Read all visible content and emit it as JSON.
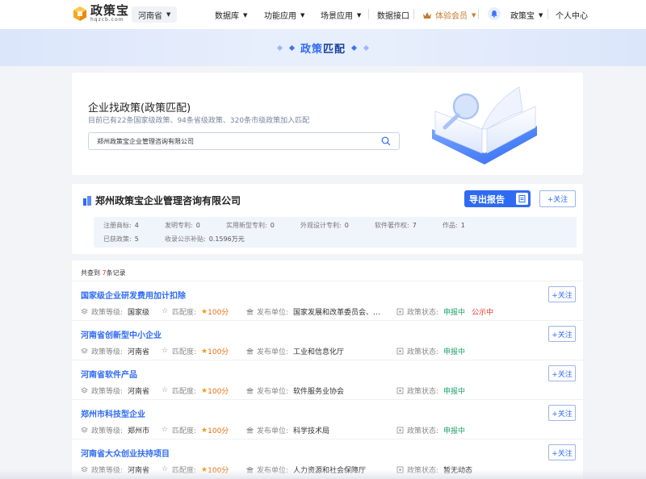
{
  "nav": {
    "logo_cn": "政策宝",
    "logo_en": "hqzcb.com",
    "region": "河南省",
    "items": [
      {
        "label": "数据库",
        "caret": true
      },
      {
        "label": "功能应用",
        "caret": true
      },
      {
        "label": "场景应用",
        "caret": true
      },
      {
        "label": "数据接口",
        "caret": false
      }
    ],
    "vip": "体验会员",
    "user": "政策宝",
    "personal": "个人中心",
    "accent": "#2f6bf2"
  },
  "banner": {
    "title_part1": "政策",
    "title_part2": "匹配"
  },
  "search": {
    "title": "企业找政策(政策匹配)",
    "subtitle": "目前已有22条国家级政策、94条省级政策、320条市级政策加入匹配",
    "value": "郑州政策宝企业管理咨询有限公司"
  },
  "company": {
    "name": "郑州政策宝企业管理咨询有限公司",
    "export_label": "导出报告",
    "follow_label": "+关注",
    "stats": [
      {
        "label": "注册商标:",
        "value": "4"
      },
      {
        "label": "发明专利:",
        "value": "0"
      },
      {
        "label": "实用新型专利:",
        "value": "0"
      },
      {
        "label": "外观设计专利:",
        "value": "0"
      },
      {
        "label": "软件著作权:",
        "value": "7"
      },
      {
        "label": "作品:",
        "value": "1"
      },
      {
        "label": "已获政策:",
        "value": "5"
      },
      {
        "label": "收录公示补贴:",
        "value": "0.1596万元"
      }
    ]
  },
  "results": {
    "count_prefix": "共查到",
    "count": "7",
    "count_suffix": "条记录",
    "labels": {
      "level": "政策等级:",
      "match": "匹配度:",
      "issuer": "发布单位:",
      "status": "政策状态:"
    },
    "items": [
      {
        "title": "国家级企业研发费用加计扣除",
        "level": "国家级",
        "match": "100分",
        "issuer": "国家发展和改革委员会、…",
        "status": "申报中",
        "status2": "公示中",
        "follow": "+关注"
      },
      {
        "title": "河南省创新型中小企业",
        "level": "河南省",
        "match": "100分",
        "issuer": "工业和信息化厅",
        "status": "申报中",
        "status2": "",
        "follow": "+关注"
      },
      {
        "title": "河南省软件产品",
        "level": "河南省",
        "match": "100分",
        "issuer": "软件服务业协会",
        "status": "申报中",
        "status2": "",
        "follow": "+关注"
      },
      {
        "title": "郑州市科技型企业",
        "level": "郑州市",
        "match": "100分",
        "issuer": "科学技术局",
        "status": "申报中",
        "status2": "",
        "follow": "+关注"
      },
      {
        "title": "河南省大众创业扶持项目",
        "level": "河南省",
        "match": "100分",
        "issuer": "人力资源和社会保障厅",
        "status": "暂无动态",
        "status2": "",
        "follow": "+关注"
      }
    ]
  }
}
